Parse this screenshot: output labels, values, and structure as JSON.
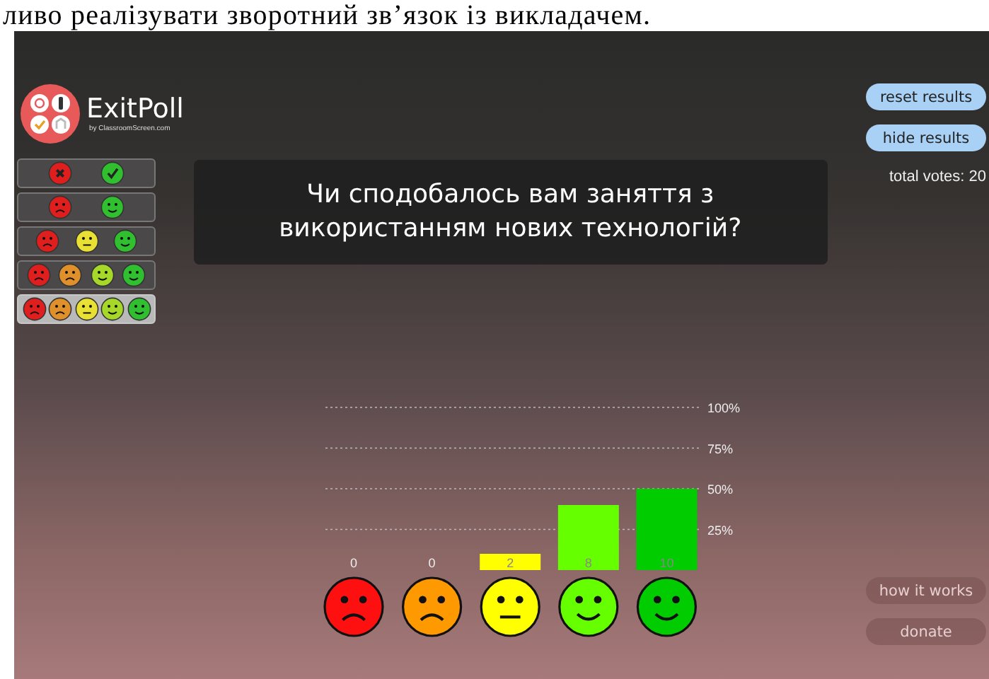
{
  "document_line": "ливо реалізувати зворотний зв’язок із викладачем.",
  "app": {
    "logo": {
      "name": "ExitPoll",
      "byline": "by ClassroomScreen.com"
    },
    "scales": [
      {
        "selected": false,
        "faces": [
          {
            "kind": "cross",
            "color": "#e01e1e"
          },
          {
            "kind": "check",
            "color": "#2fbf2f"
          }
        ]
      },
      {
        "selected": false,
        "faces": [
          {
            "kind": "sad",
            "color": "#e01e1e"
          },
          {
            "kind": "happy",
            "color": "#2fbf2f"
          }
        ]
      },
      {
        "selected": false,
        "faces": [
          {
            "kind": "sad",
            "color": "#e01e1e"
          },
          {
            "kind": "neutral",
            "color": "#e8e032"
          },
          {
            "kind": "happy",
            "color": "#2fbf2f"
          }
        ]
      },
      {
        "selected": false,
        "faces": [
          {
            "kind": "sad",
            "color": "#e01e1e"
          },
          {
            "kind": "sad",
            "color": "#e0902a"
          },
          {
            "kind": "happy",
            "color": "#a6d82a"
          },
          {
            "kind": "happy",
            "color": "#2fbf2f"
          }
        ]
      },
      {
        "selected": true,
        "faces": [
          {
            "kind": "sad",
            "color": "#e01e1e"
          },
          {
            "kind": "sad",
            "color": "#e0902a"
          },
          {
            "kind": "neutral",
            "color": "#e8e032"
          },
          {
            "kind": "happy",
            "color": "#a6d82a"
          },
          {
            "kind": "happy",
            "color": "#2fbf2f"
          }
        ]
      }
    ],
    "question": "Чи сподобалось вам заняття з використанням нових технологій?",
    "chart": {
      "chart_data": {
        "type": "bar",
        "grid": true,
        "ylim": [
          0,
          100
        ],
        "yticks": [
          {
            "value": 25,
            "label": "25%"
          },
          {
            "value": 50,
            "label": "50%"
          },
          {
            "value": 75,
            "label": "75%"
          },
          {
            "value": 100,
            "label": "100%"
          }
        ],
        "series": [
          {
            "values": [
              0,
              0,
              10,
              40,
              50
            ]
          }
        ],
        "value_labels": [
          "0",
          "0",
          "2",
          "8",
          "10"
        ]
      },
      "faces": [
        {
          "kind": "sad",
          "color": "#ff1010"
        },
        {
          "kind": "sad",
          "color": "#ff9900"
        },
        {
          "kind": "neutral",
          "color": "#ffff00"
        },
        {
          "kind": "happy",
          "color": "#66ff00"
        },
        {
          "kind": "happy",
          "color": "#00cc00"
        }
      ]
    },
    "top_buttons": [
      "reset results",
      "hide results"
    ],
    "total_votes": "total votes: 20",
    "bottom_buttons": [
      "how it works",
      "donate"
    ]
  }
}
